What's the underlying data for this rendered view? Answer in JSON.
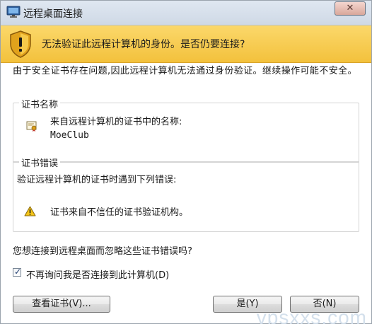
{
  "window": {
    "title": "远程桌面连接",
    "close_glyph": "✕"
  },
  "banner": {
    "text": "无法验证此远程计算机的身份。是否仍要连接?",
    "icon": "shield-warning-icon",
    "color": "#f3c13c"
  },
  "description": "由于安全证书存在问题,因此远程计算机无法通过身份验证。继续操作可能不安全。",
  "cert_name_group": {
    "legend": "证书名称",
    "label": "来自远程计算机的证书中的名称:",
    "name": "MoeClub"
  },
  "cert_error_group": {
    "legend": "证书错误",
    "intro": "验证远程计算机的证书时遇到下列错误:",
    "errors": [
      "证书来自不信任的证书验证机构。"
    ]
  },
  "question": "您想连接到远程桌面而忽略这些证书错误吗?",
  "dont_ask": {
    "checked": true,
    "label": "不再询问我是否连接到此计算机(D)"
  },
  "buttons": {
    "view_cert": "查看证书(V)...",
    "yes": "是(Y)",
    "no": "否(N)"
  },
  "watermark": "vpsxxs.com"
}
